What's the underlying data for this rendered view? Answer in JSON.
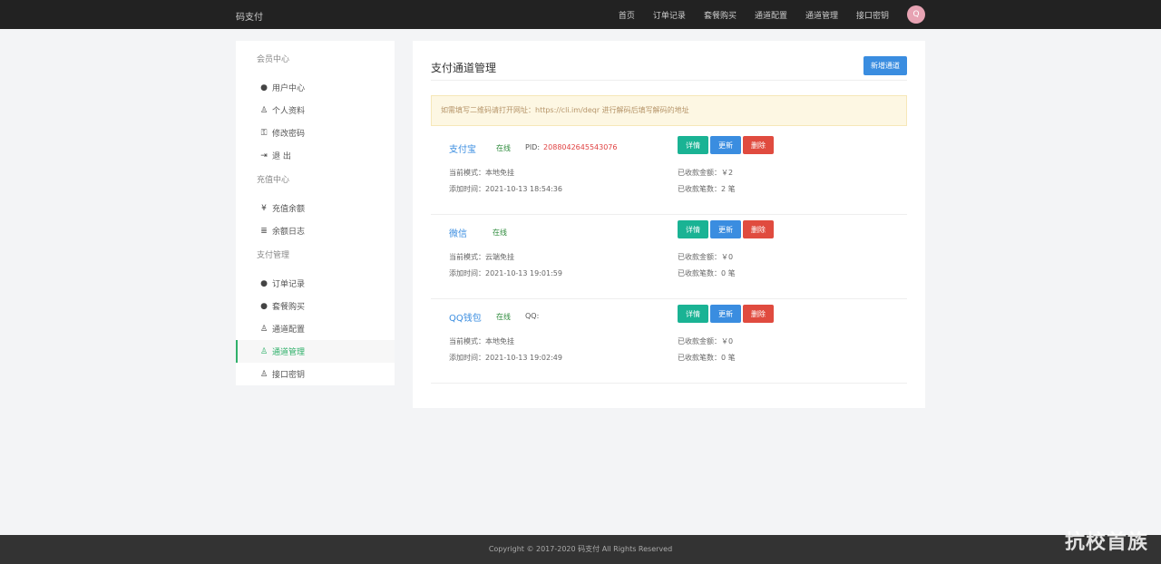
{
  "header": {
    "brand": "码支付",
    "nav": [
      "首页",
      "订单记录",
      "套餐购买",
      "通道配置",
      "通道管理",
      "接口密钥"
    ],
    "avatar_letter": "Q"
  },
  "sidebar": {
    "groups": [
      {
        "title": "会员中心",
        "items": [
          {
            "label": "用户中心",
            "icon": "user-circle-icon"
          },
          {
            "label": "个人资料",
            "icon": "user-icon"
          },
          {
            "label": "修改密码",
            "icon": "key-icon"
          },
          {
            "label": "退 出",
            "icon": "sign-out-icon"
          }
        ]
      },
      {
        "title": "充值中心",
        "items": [
          {
            "label": "充值余额",
            "icon": "yen-icon"
          },
          {
            "label": "余额日志",
            "icon": "list-icon"
          }
        ]
      },
      {
        "title": "支付管理",
        "items": [
          {
            "label": "订单记录",
            "icon": "user-circle-icon"
          },
          {
            "label": "套餐购买",
            "icon": "user-circle-icon"
          },
          {
            "label": "通道配置",
            "icon": "user-icon"
          },
          {
            "label": "通道管理",
            "icon": "user-icon",
            "active": true
          },
          {
            "label": "接口密钥",
            "icon": "user-icon"
          }
        ]
      }
    ]
  },
  "main": {
    "title": "支付通道管理",
    "add_button": "新增通道",
    "notice": "如需填写二维码请打开网址：https://cli.im/deqr 进行解码后填写解码的地址",
    "buttons": {
      "info": "详情",
      "update": "更新",
      "delete": "删除"
    },
    "channels": [
      {
        "name": "支付宝",
        "status": "在线",
        "id_label": "PID:",
        "id_value": "2088042645543076",
        "mode": "当前模式：本地免挂",
        "time": "添加时间：2021-10-13 18:54:36",
        "amount": "已收款金额：￥2",
        "count": "已收款笔数：2 笔"
      },
      {
        "name": "微信",
        "status": "在线",
        "id_label": "",
        "id_value": "",
        "mode": "当前模式：云端免挂",
        "time": "添加时间：2021-10-13 19:01:59",
        "amount": "已收款金额：￥0",
        "count": "已收款笔数：0 笔"
      },
      {
        "name": "QQ钱包",
        "status": "在线",
        "id_label": "QQ:",
        "id_value": "",
        "mode": "当前模式：本地免挂",
        "time": "添加时间：2021-10-13 19:02:49",
        "amount": "已收款金额：￥0",
        "count": "已收款笔数：0 笔"
      }
    ]
  },
  "footer": {
    "text": "Copyright © 2017-2020 码支付 All Rights Reserved"
  },
  "watermark": "抗校首族"
}
